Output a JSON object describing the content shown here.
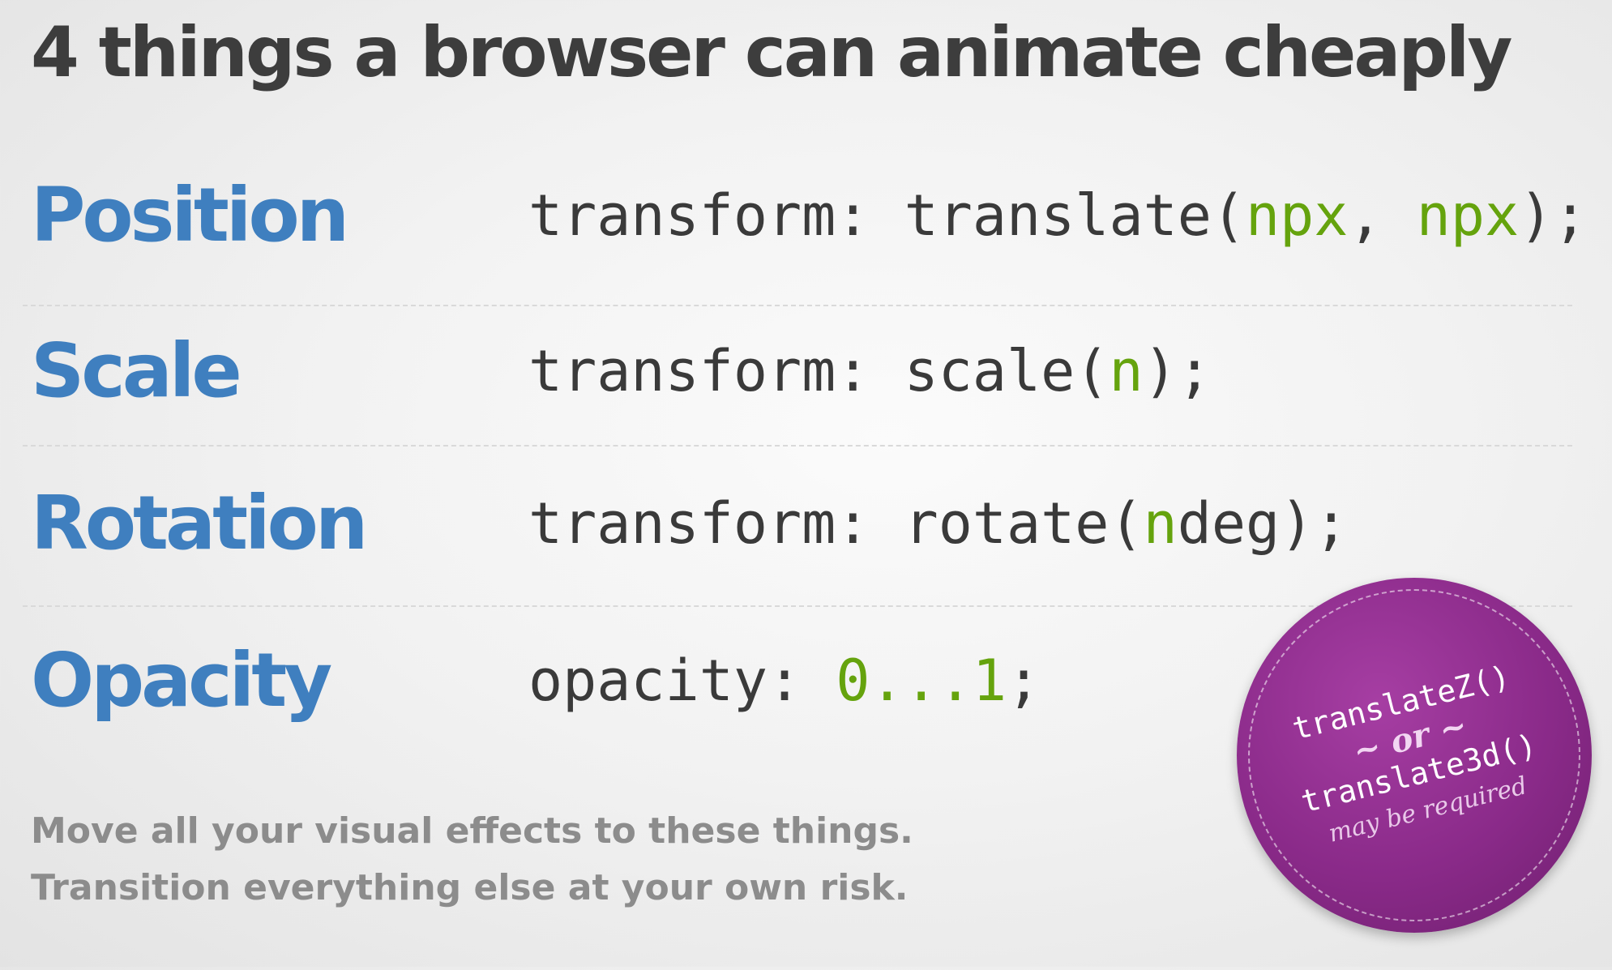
{
  "title": "4 things a browser can animate cheaply",
  "rows": [
    {
      "label": "Position",
      "code": [
        {
          "text": "transform: translate(",
          "kind": "code"
        },
        {
          "text": "npx",
          "kind": "value"
        },
        {
          "text": ", ",
          "kind": "code"
        },
        {
          "text": "npx",
          "kind": "value"
        },
        {
          "text": ");",
          "kind": "code"
        }
      ]
    },
    {
      "label": "Scale",
      "code": [
        {
          "text": "transform: scale(",
          "kind": "code"
        },
        {
          "text": "n",
          "kind": "value"
        },
        {
          "text": ");",
          "kind": "code"
        }
      ]
    },
    {
      "label": "Rotation",
      "code": [
        {
          "text": "transform: rotate(",
          "kind": "code"
        },
        {
          "text": "n",
          "kind": "value"
        },
        {
          "text": "deg);",
          "kind": "code"
        }
      ]
    },
    {
      "label": "Opacity",
      "code": [
        {
          "text": "opacity: ",
          "kind": "code"
        },
        {
          "text": "0...1",
          "kind": "value"
        },
        {
          "text": ";",
          "kind": "code"
        }
      ]
    }
  ],
  "notes": {
    "line1": "Move all your visual effects to these things.",
    "line2": "Transition everything else at your own risk."
  },
  "badge": {
    "line1": "translateZ()",
    "or": "~ or ~",
    "line2": "translate3d()",
    "note": "may be required"
  },
  "colors": {
    "label_blue": "#3f7fbf",
    "value_green": "#65a30d",
    "title_gray": "#3d3d3d",
    "badge_purple": "#8a2a89"
  }
}
